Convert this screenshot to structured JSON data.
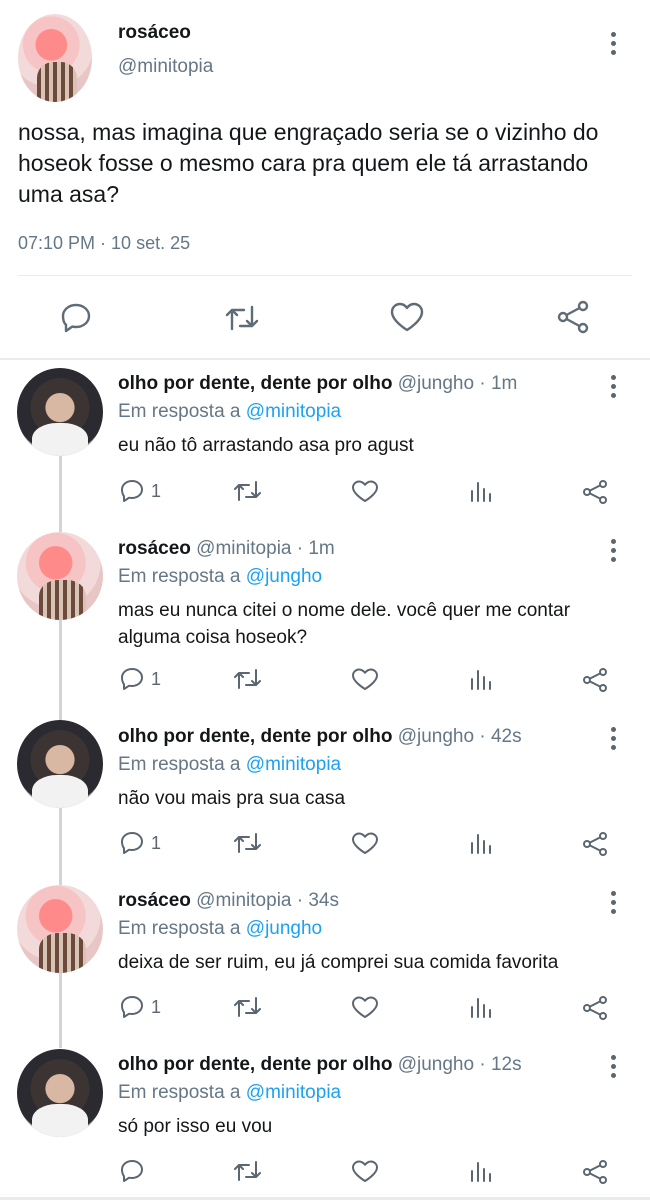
{
  "main_tweet": {
    "display_name": "rosáceo",
    "handle": "@minitopia",
    "text": "nossa, mas imagina que engraçado seria se o vizinho do hoseok fosse o mesmo cara pra quem ele tá arrastando uma asa?",
    "timestamp": "07:10 PM · 10 set. 25"
  },
  "replies": [
    {
      "display_name": "olho por dente, dente por olho",
      "meta": "@jungho · 1m",
      "reply_prefix": "Em resposta a ",
      "reply_to": "@minitopia",
      "text": "eu não tô arrastando asa pro agust",
      "reply_count": "1"
    },
    {
      "display_name": "rosáceo",
      "meta": "@minitopia · 1m",
      "reply_prefix": "Em resposta a ",
      "reply_to": "@jungho",
      "text": "mas eu nunca citei o nome dele. você quer me contar alguma coisa hoseok?",
      "reply_count": "1"
    },
    {
      "display_name": "olho por dente, dente por olho",
      "meta": "@jungho · 42s",
      "reply_prefix": "Em resposta a ",
      "reply_to": "@minitopia",
      "text": "não vou mais pra sua casa",
      "reply_count": "1"
    },
    {
      "display_name": "rosáceo",
      "meta": "@minitopia · 34s",
      "reply_prefix": "Em resposta a ",
      "reply_to": "@jungho",
      "text": "deixa de ser ruim, eu já comprei sua comida favorita",
      "reply_count": "1"
    },
    {
      "display_name": "olho por dente, dente por olho",
      "meta": "@jungho · 12s",
      "reply_prefix": "Em resposta a ",
      "reply_to": "@minitopia",
      "text": "só por isso eu vou",
      "reply_count": ""
    }
  ]
}
